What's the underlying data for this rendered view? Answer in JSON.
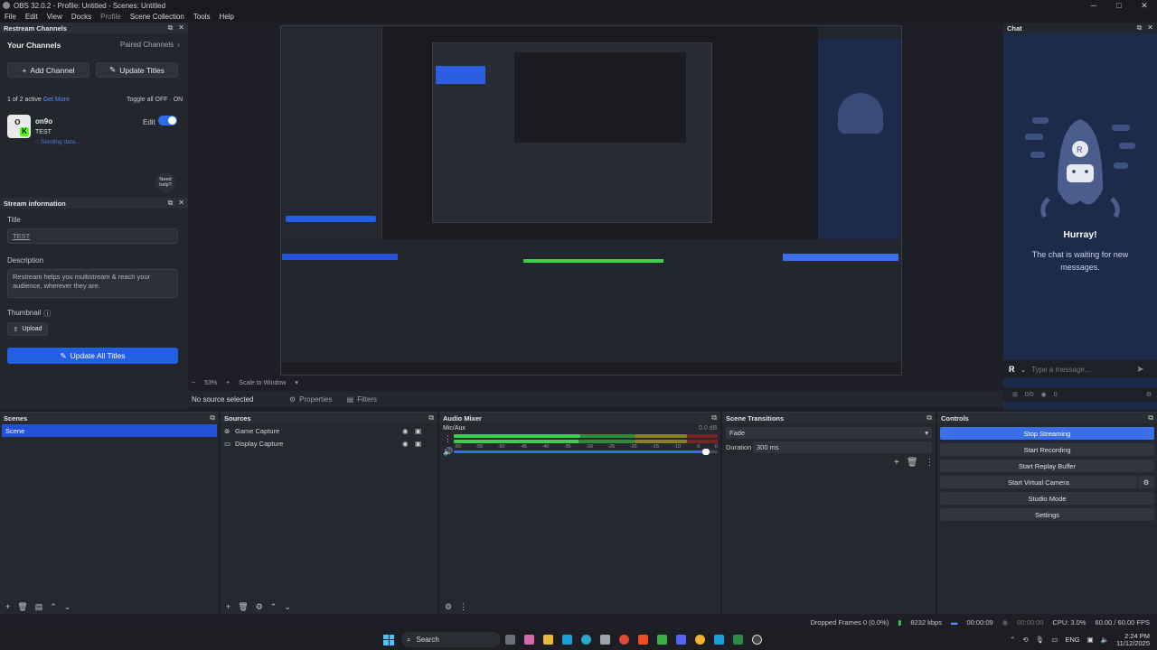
{
  "window": {
    "title": "OBS 32.0.2 - Profile: Untitled - Scenes: Untitled",
    "controls": [
      "─",
      "□",
      "✕"
    ]
  },
  "menu": [
    "File",
    "Edit",
    "View",
    "Docks",
    "Profile",
    "Scene Collection",
    "Tools",
    "Help"
  ],
  "restream": {
    "header": "Restream Channels",
    "your_channels": "Your Channels",
    "paired_channels": "Paired Channels",
    "add_channel": "Add Channel",
    "update_titles": "Update Titles",
    "active_count": "1 of 2 active",
    "get_more": "Get More",
    "toggle_all": "Toggle all OFF · ON",
    "channel": {
      "name": "on9o",
      "title": "TEST",
      "status": "Sending data...",
      "edit": "Edit"
    },
    "need_help": "Need help?"
  },
  "stream_info": {
    "header": "Stream information",
    "title_label": "Title",
    "title_value": "TEST",
    "description_label": "Description",
    "description_value": "Restream helps you multistream & reach your audience, wherever they are.",
    "thumbnail_label": "Thumbnail",
    "upload": "Upload",
    "update_all": "Update All Titles"
  },
  "preview": {
    "zoom": "53%",
    "scale": "Scale to Window",
    "no_source": "No source selected",
    "properties": "Properties",
    "filters": "Filters"
  },
  "chat": {
    "header": "Chat",
    "hurray": "Hurray!",
    "waiting": "The chat is waiting for new messages.",
    "placeholder": "Type a message...",
    "viewers": "0/0",
    "eye": "0"
  },
  "scenes": {
    "header": "Scenes",
    "items": [
      "Scene"
    ]
  },
  "sources": {
    "header": "Sources",
    "items": [
      "Game Capture",
      "Display Capture"
    ]
  },
  "mixer": {
    "header": "Audio Mixer",
    "track": "Mic/Aux",
    "db": "0.0 dB",
    "ticks": [
      "-60",
      "-55",
      "-50",
      "-45",
      "-40",
      "-35",
      "-30",
      "-25",
      "-20",
      "-15",
      "-10",
      "-5",
      "0"
    ],
    "volume_level": 0.97
  },
  "transitions": {
    "header": "Scene Transitions",
    "type": "Fade",
    "duration_label": "Duration",
    "duration": "300 ms"
  },
  "controls": {
    "header": "Controls",
    "buttons": [
      "Stop Streaming",
      "Start Recording",
      "Start Replay Buffer",
      "Start Virtual Camera",
      "Studio Mode",
      "Settings"
    ]
  },
  "status": {
    "dropped": "Dropped Frames 0 (0.0%)",
    "kbps": "8232 kbps",
    "stream_time": "00:00:09",
    "rec_time": "00:00:00",
    "cpu": "CPU: 3.0%",
    "fps": "60.00 / 60.00 FPS"
  },
  "taskbar": {
    "search": "Search",
    "lang": "ENG",
    "time": "2:24 PM",
    "date": "11/12/2025"
  },
  "colors": {
    "accent": "#2160e5",
    "meter_green": "#3bd14a",
    "meter_yellow": "#c5b62a",
    "meter_red": "#c23232",
    "chat_bg": "#1d2b4a"
  }
}
